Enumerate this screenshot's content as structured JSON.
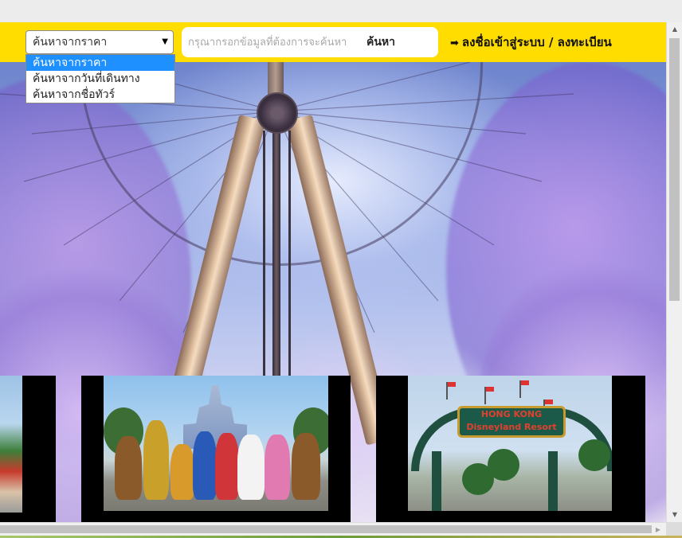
{
  "search": {
    "select_value": "ค้นหาจากราคา",
    "options": [
      "ค้นหาจากราคา",
      "ค้นหาจากวันที่เดินทาง",
      "ค้นหาจากชื่อทัวร์"
    ],
    "selected_index": 0,
    "placeholder": "กรุณากรอกข้อมูลที่ต้องการจะค้นหา",
    "button_label": "ค้นหา"
  },
  "nav": {
    "login_label": "ลงชื่อเข้าสู่ระบบ / ลงทะเบียน",
    "login_icon": "sign-in-icon"
  },
  "hero": {
    "image": "hong-kong-observation-wheel"
  },
  "cards": [
    {
      "image": "garden-photo"
    },
    {
      "image": "disney-characters-photo"
    },
    {
      "image": "disneyland-gate-photo",
      "sign_text": "HONG KONG Disneyland Resort"
    }
  ],
  "colors": {
    "navbar": "#ffdd00",
    "selected_option": "#1e90ff"
  }
}
